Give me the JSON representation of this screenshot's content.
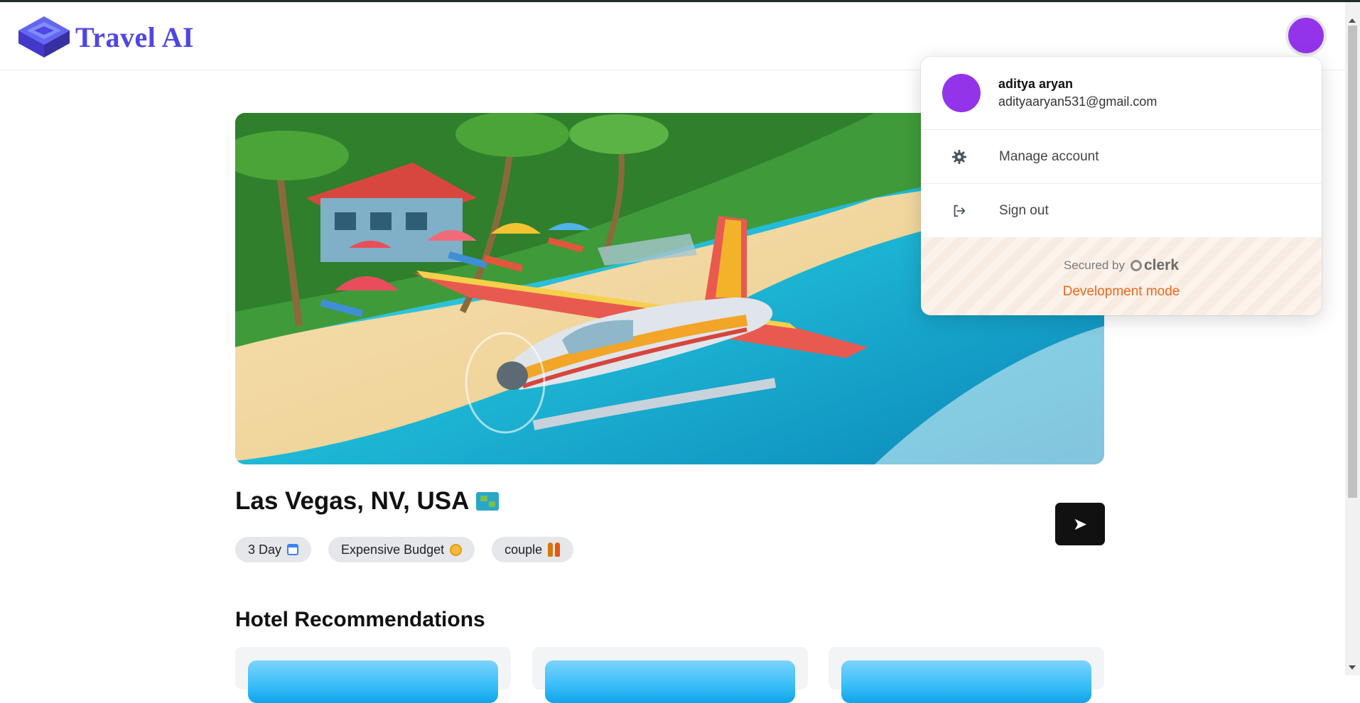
{
  "header": {
    "brand": "Travel AI",
    "brand_color": "#4f46e5",
    "avatar_color": "#9333ea"
  },
  "trip": {
    "destination": "Las Vegas, NV, USA",
    "destination_icon": "world-map-icon",
    "tags": [
      {
        "label": "3 Day",
        "icon": "calendar-icon"
      },
      {
        "label": "Expensive Budget",
        "icon": "coin-icon"
      },
      {
        "label": "couple",
        "icon": "couple-icon"
      }
    ],
    "share_icon": "send-icon"
  },
  "hotels": {
    "title": "Hotel Recommendations"
  },
  "user_menu": {
    "name": "aditya aryan",
    "email": "adityaaryan531@gmail.com",
    "manage_label": "Manage account",
    "signout_label": "Sign out",
    "secured_by": "Secured by",
    "provider": "clerk",
    "dev_mode": "Development mode",
    "dev_mode_color": "#ea6a1e"
  }
}
